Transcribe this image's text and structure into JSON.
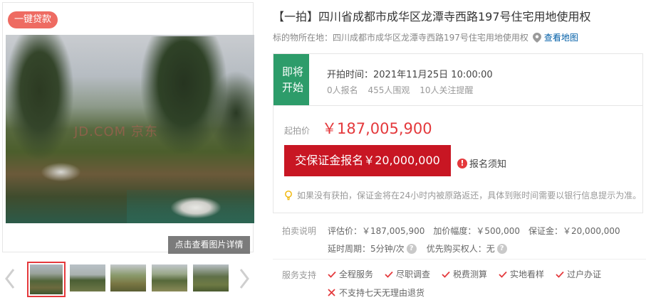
{
  "gallery": {
    "loan_badge": "一键贷款",
    "watermark": "JD.COM 京东",
    "view_detail": "点击查看图片详情",
    "thumbnails": [
      "thumb-1",
      "thumb-2",
      "thumb-3",
      "thumb-4",
      "thumb-5"
    ],
    "active_thumbnail": 0
  },
  "title": "【一拍】四川省成都市成华区龙潭寺西路197号住宅用地使用权",
  "location": {
    "label": "标的物所在地：",
    "value": "四川成都市成华区龙潭寺西路197号住宅用地使用权",
    "map_link": "查看地图"
  },
  "auction": {
    "status_line1": "即将",
    "status_line2": "开始",
    "start_time": "开拍时间：2021年11月25日 10:00:00",
    "signups": "0人报名",
    "views": "455人围观",
    "reminders": "10人关注提醒",
    "price_label": "起拍价",
    "price": "￥187,005,900",
    "bid_button": "交保证金报名￥20,000,000",
    "notice": "报名须知",
    "tip": "如果没有获拍，保证金将在24小时内被原路返还，具体到账时间需要以银行信息提示为准。"
  },
  "details": {
    "label": "拍卖说明",
    "appraisal": "评估价：￥187,005,900",
    "increment": "加价幅度：￥500,000",
    "deposit": "保证金：￥20,000,000",
    "delay": "延时周期：5分钟/次",
    "priority": "优先购买权人：无"
  },
  "services": {
    "label": "服务支持",
    "items": [
      "全程服务",
      "尽职调查",
      "税费测算",
      "实地看样",
      "过户办证"
    ],
    "no_return": "不支持七天无理由退货"
  },
  "colors": {
    "accent_red": "#e4393c",
    "button_red": "#c81623",
    "status_green": "#2d9c6a",
    "badge_coral": "#ee6b62",
    "link_blue": "#005ea7"
  }
}
